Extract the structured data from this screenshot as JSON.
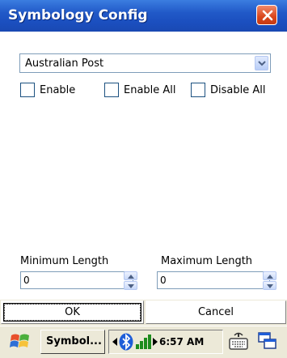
{
  "window": {
    "title": "Symbology Config"
  },
  "symbology_select": {
    "selected": "Australian Post"
  },
  "options": {
    "enable_label": "Enable",
    "enable_all_label": "Enable All",
    "disable_all_label": "Disable All"
  },
  "length": {
    "min_label": "Minimum Length",
    "min_value": "0",
    "max_label": "Maximum Length",
    "max_value": "0"
  },
  "buttons": {
    "ok": "OK",
    "cancel": "Cancel"
  },
  "taskbar": {
    "task_label": "Symbol...",
    "time": "6:57 AM"
  },
  "colors": {
    "title_bar": "#2159c8",
    "close": "#d9461c",
    "face": "#ece9d8"
  }
}
